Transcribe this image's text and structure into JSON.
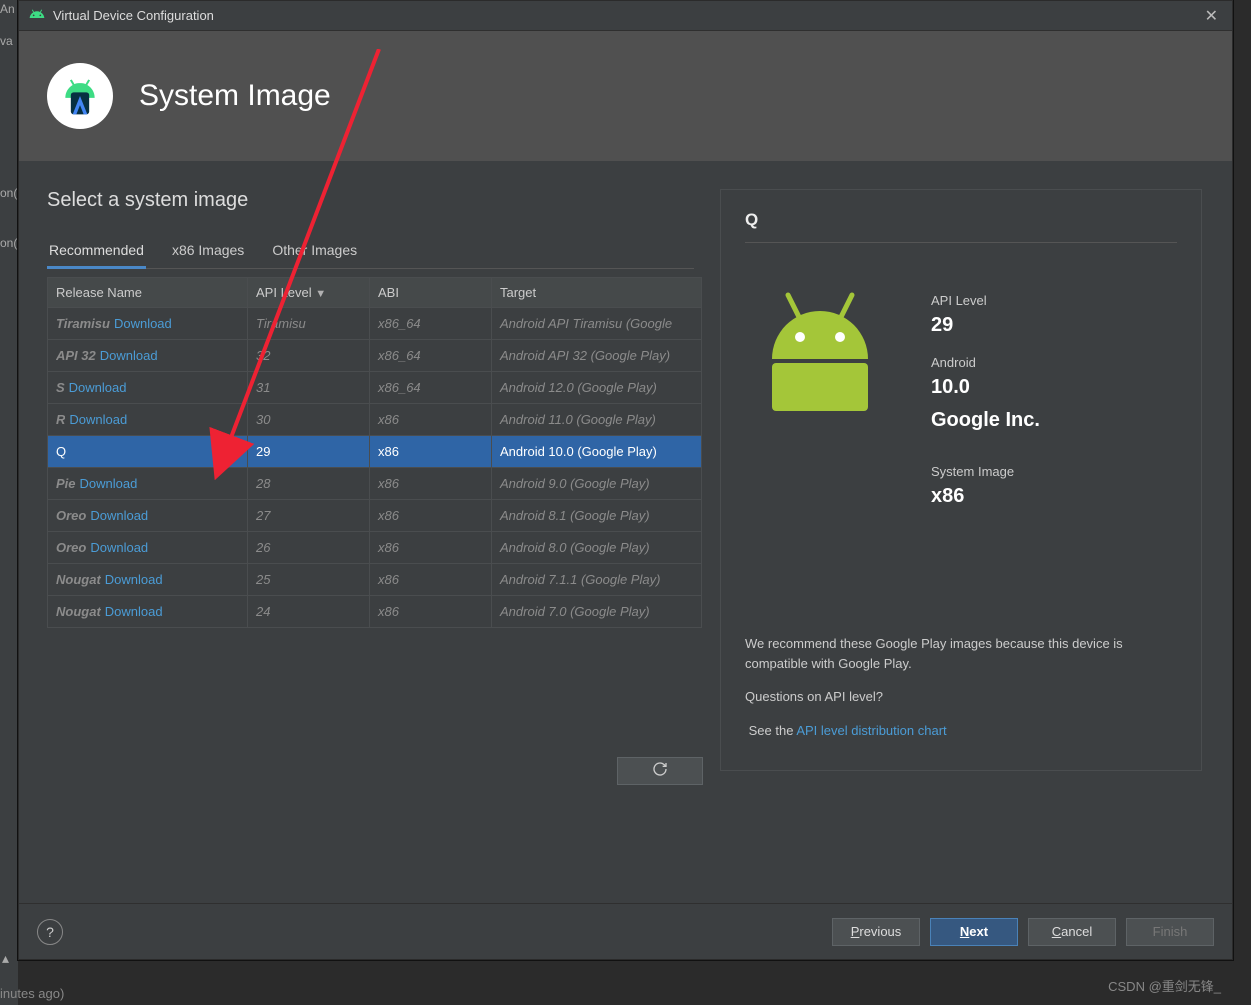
{
  "left_remnant": {
    "line1": "An",
    "line2": "va",
    "line3": "on(",
    "line4": "on("
  },
  "bottom_text": "inutes ago)",
  "titlebar": {
    "title": "Virtual Device Configuration"
  },
  "header": {
    "title": "System Image"
  },
  "subtitle": "Select a system image",
  "tabs": [
    {
      "label": "Recommended",
      "active": true
    },
    {
      "label": "x86 Images",
      "active": false
    },
    {
      "label": "Other Images",
      "active": false
    }
  ],
  "columns": {
    "release": "Release Name",
    "api": "API Level",
    "abi": "ABI",
    "target": "Target"
  },
  "rows": [
    {
      "name": "Tiramisu",
      "dl": "Download",
      "api": "Tiramisu",
      "abi": "x86_64",
      "target": "Android API Tiramisu (Google",
      "selected": false,
      "dim": true
    },
    {
      "name": "API 32",
      "dl": "Download",
      "api": "32",
      "abi": "x86_64",
      "target": "Android API 32 (Google Play)",
      "selected": false,
      "dim": true
    },
    {
      "name": "S",
      "dl": "Download",
      "api": "31",
      "abi": "x86_64",
      "target": "Android 12.0 (Google Play)",
      "selected": false,
      "dim": true
    },
    {
      "name": "R",
      "dl": "Download",
      "api": "30",
      "abi": "x86",
      "target": "Android 11.0 (Google Play)",
      "selected": false,
      "dim": true
    },
    {
      "name": "Q",
      "dl": "",
      "api": "29",
      "abi": "x86",
      "target": "Android 10.0 (Google Play)",
      "selected": true,
      "dim": false
    },
    {
      "name": "Pie",
      "dl": "Download",
      "api": "28",
      "abi": "x86",
      "target": "Android 9.0 (Google Play)",
      "selected": false,
      "dim": true
    },
    {
      "name": "Oreo",
      "dl": "Download",
      "api": "27",
      "abi": "x86",
      "target": "Android 8.1 (Google Play)",
      "selected": false,
      "dim": true
    },
    {
      "name": "Oreo",
      "dl": "Download",
      "api": "26",
      "abi": "x86",
      "target": "Android 8.0 (Google Play)",
      "selected": false,
      "dim": true
    },
    {
      "name": "Nougat",
      "dl": "Download",
      "api": "25",
      "abi": "x86",
      "target": "Android 7.1.1 (Google Play)",
      "selected": false,
      "dim": true
    },
    {
      "name": "Nougat",
      "dl": "Download",
      "api": "24",
      "abi": "x86",
      "target": "Android 7.0 (Google Play)",
      "selected": false,
      "dim": true
    }
  ],
  "details": {
    "title": "Q",
    "api_label": "API Level",
    "api_value": "29",
    "android_label": "Android",
    "android_value": "10.0",
    "vendor": "Google Inc.",
    "sysimg_label": "System Image",
    "sysimg_value": "x86",
    "recommend_text": "We recommend these Google Play images because this device is compatible with Google Play.",
    "question_text": "Questions on API level?",
    "see_prefix": "See the ",
    "see_link": "API level distribution chart"
  },
  "buttons": {
    "previous": "Previous",
    "next": "Next",
    "cancel": "Cancel",
    "finish": "Finish"
  },
  "watermark": "CSDN @重剑无锋_"
}
